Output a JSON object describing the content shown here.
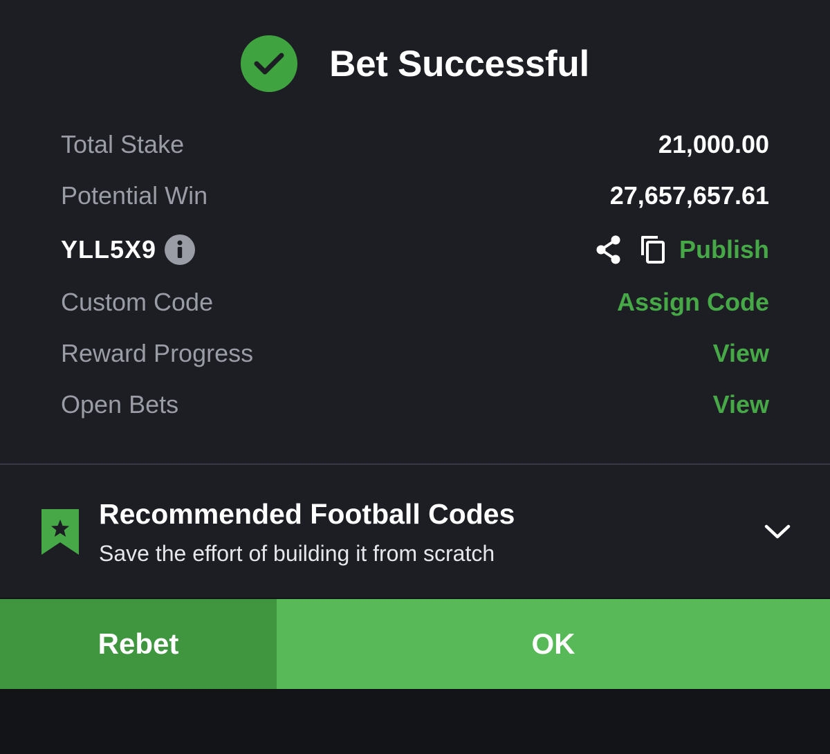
{
  "dialog": {
    "title": "Bet Successful",
    "rows": {
      "total_stake": {
        "label": "Total Stake",
        "value": "21,000.00"
      },
      "potential_win": {
        "label": "Potential Win",
        "value": "27,657,657.61"
      },
      "booking": {
        "code": "YLL5X9",
        "publish_label": "Publish"
      },
      "custom_code": {
        "label": "Custom Code",
        "action": "Assign Code"
      },
      "reward_progress": {
        "label": "Reward Progress",
        "action": "View"
      },
      "open_bets": {
        "label": "Open Bets",
        "action": "View"
      }
    }
  },
  "recommended": {
    "title": "Recommended Football Codes",
    "subtitle": "Save the effort of building it from scratch"
  },
  "actions": {
    "rebet_label": "Rebet",
    "ok_label": "OK"
  },
  "colors": {
    "accent_green": "#46a846",
    "button_rebet": "#3f963f",
    "button_ok": "#57b957",
    "panel_bg": "#1c1e24"
  },
  "icons": {
    "status": "check-circle-icon",
    "info": "info-icon",
    "share": "share-icon",
    "copy": "copy-icon",
    "bookmark": "bookmark-star-icon",
    "expand": "chevron-down-icon"
  }
}
